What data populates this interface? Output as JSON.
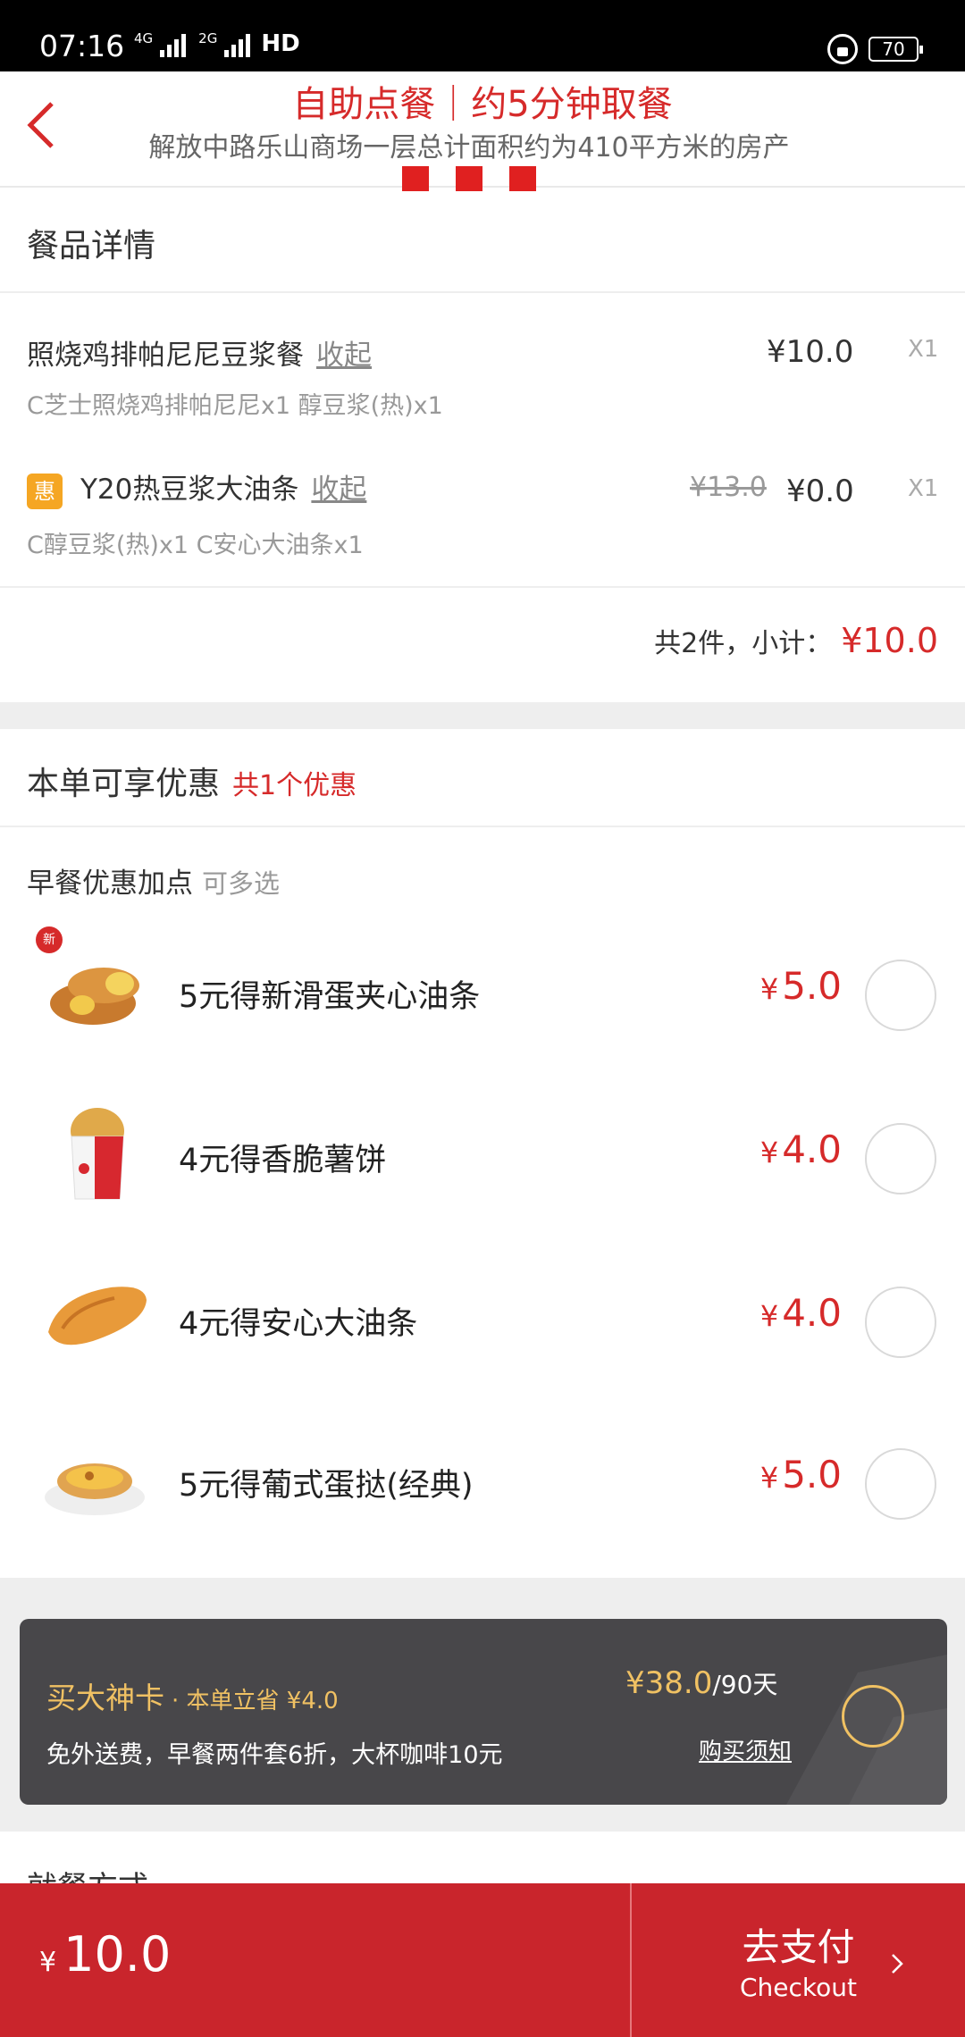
{
  "status_bar": {
    "time": "07:16",
    "network_1": "4G",
    "network_2": "2G",
    "hd": "HD",
    "battery": "70"
  },
  "header": {
    "title": "自助点餐｜约5分钟取餐",
    "subtitle": "解放中路乐山商场一层总计面积约为410平方米的房产",
    "back_icon": "chevron-left-icon"
  },
  "meal_details": {
    "title": "餐品详情",
    "items": [
      {
        "name": "照烧鸡排帕尼尼豆浆餐",
        "fold_label": "收起",
        "detail": "C芝士照烧鸡排帕尼尼x1  醇豆浆(热)x1",
        "price": "¥10.0",
        "qty": "X1"
      },
      {
        "badge": "惠",
        "name": "Y20热豆浆大油条",
        "fold_label": "收起",
        "detail": "C醇豆浆(热)x1  C安心大油条x1",
        "original_price": "¥13.0",
        "price": "¥0.0",
        "qty": "X1"
      }
    ],
    "subtotal_label": "共2件，小计：",
    "subtotal_value": "¥10.0"
  },
  "promotions": {
    "title": "本单可享优惠",
    "count_label": "共1个优惠",
    "addon_group": "早餐优惠加点",
    "addon_multi": "可多选",
    "addons": [
      {
        "label": "5元得新滑蛋夹心油条",
        "yen": "¥",
        "price": "5.0",
        "badge": "新",
        "icon": "egg-fritter-thumbnail"
      },
      {
        "label": "4元得香脆薯饼",
        "yen": "¥",
        "price": "4.0",
        "icon": "hash-brown-thumbnail"
      },
      {
        "label": "4元得安心大油条",
        "yen": "¥",
        "price": "4.0",
        "icon": "youtiao-thumbnail"
      },
      {
        "label": "5元得葡式蛋挞(经典)",
        "yen": "¥",
        "price": "5.0",
        "icon": "egg-tart-thumbnail"
      }
    ]
  },
  "member_card": {
    "title": "买大神卡",
    "saving": "· 本单立省 ¥4.0",
    "description": "免外送费，早餐两件套6折，大杯咖啡10元",
    "price": "¥38.0",
    "period": "/90天",
    "notice_link": "购买须知"
  },
  "peek_section": "就餐方式",
  "bottom_bar": {
    "yen": "¥",
    "total": "10.0",
    "checkout_cn": "去支付",
    "checkout_en": "Checkout"
  },
  "colors": {
    "accent_red": "#d62a2a",
    "bottom_bar": "#c9252c",
    "gold": "#f0c163",
    "card_bg": "#48474a"
  }
}
